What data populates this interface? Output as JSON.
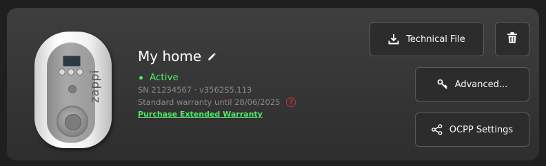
{
  "device": {
    "name": "My home",
    "brand_text": "zappi",
    "status": "Active",
    "serial_line": "SN 21234567 · v3562S5.113",
    "warranty_text": "Standard warranty until 28/06/2025",
    "purchase_link": "Purchase Extended Warranty"
  },
  "actions": {
    "technical_file": "Technical File",
    "advanced": "Advanced...",
    "ocpp_settings": "OCPP Settings"
  },
  "icons": {
    "edit": "pencil-icon",
    "help": "help-icon",
    "download": "download-icon",
    "delete": "trash-icon",
    "advanced": "key-icon",
    "ocpp": "share-nodes-icon"
  },
  "colors": {
    "status_active": "#4ef06a",
    "link": "#52e86a",
    "help": "#cc3333",
    "card_bg": "#353535"
  }
}
